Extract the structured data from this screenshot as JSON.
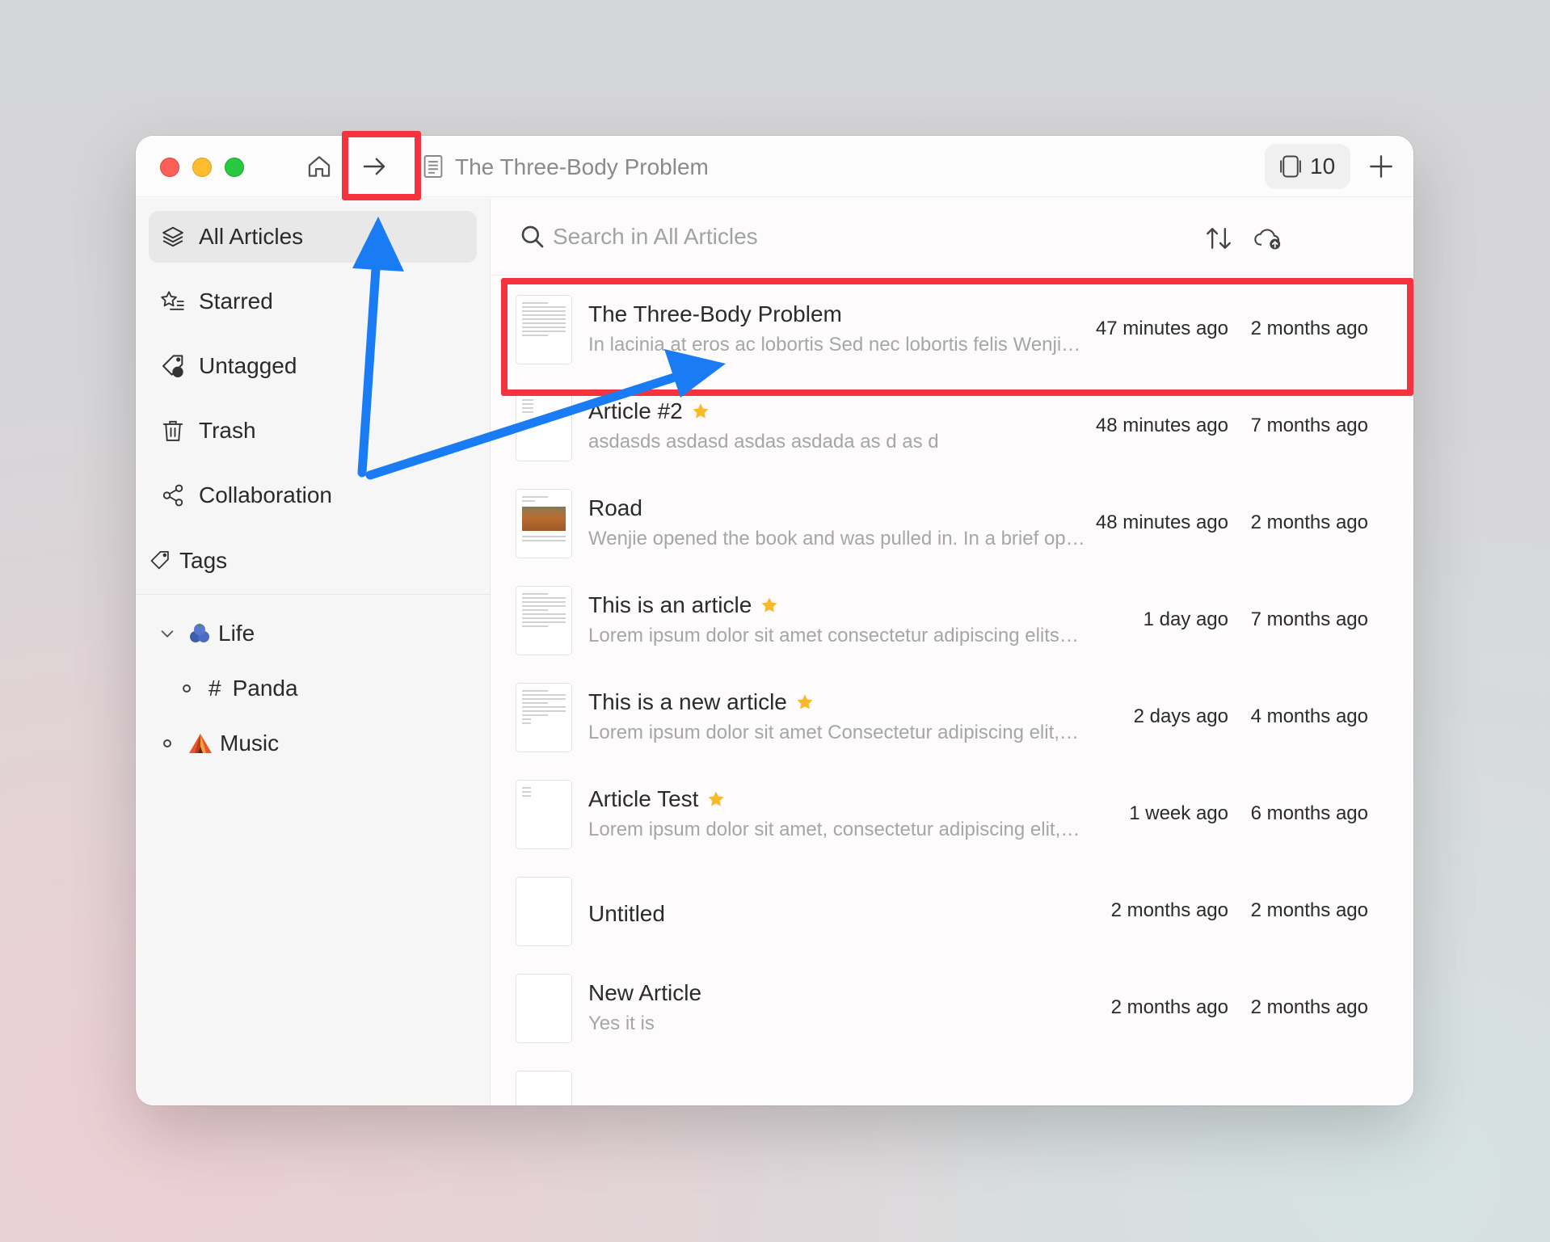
{
  "window": {
    "tab_title": "The Three-Body Problem",
    "tab_count": "10"
  },
  "sidebar": {
    "items": [
      {
        "label": "All Articles",
        "icon": "stack-icon",
        "active": true
      },
      {
        "label": "Starred",
        "icon": "star-list-icon"
      },
      {
        "label": "Untagged",
        "icon": "tag-question-icon"
      },
      {
        "label": "Trash",
        "icon": "trash-icon"
      },
      {
        "label": "Collaboration",
        "icon": "share-icon"
      }
    ],
    "tags_header": "Tags",
    "tags": [
      {
        "label": "Life",
        "icon": "blueberry-emoji",
        "expanded": true
      },
      {
        "label": "Panda",
        "prefix": "#"
      },
      {
        "label": "Music",
        "icon": "tent-emoji"
      }
    ]
  },
  "search": {
    "placeholder": "Search in All Articles"
  },
  "articles": [
    {
      "title": "The Three-Body Problem",
      "snippet": "In lacinia at eros ac lobortis Sed nec lobortis felis Wenji…",
      "modified": "47 minutes ago",
      "created": "2 months ago",
      "starred": false
    },
    {
      "title": "Article #2",
      "snippet": "asdasds asdasd asdas asdada as d as d",
      "modified": "48 minutes ago",
      "created": "7 months ago",
      "starred": true
    },
    {
      "title": "Road",
      "snippet": "Wenjie opened the book and was pulled in. In a brief op…",
      "modified": "48 minutes ago",
      "created": "2 months ago",
      "starred": false
    },
    {
      "title": "This is an article",
      "snippet": "Lorem ipsum dolor sit amet consectetur adipiscing elits…",
      "modified": "1 day ago",
      "created": "7 months ago",
      "starred": true
    },
    {
      "title": "This is a new article",
      "snippet": "Lorem ipsum dolor sit amet Consectetur adipiscing elit,…",
      "modified": "2 days ago",
      "created": "4 months ago",
      "starred": true
    },
    {
      "title": "Article Test",
      "snippet": "Lorem ipsum dolor sit amet, consectetur adipiscing elit,…",
      "modified": "1 week ago",
      "created": "6 months ago",
      "starred": true
    },
    {
      "title": "Untitled",
      "snippet": "",
      "modified": "2 months ago",
      "created": "2 months ago",
      "starred": false
    },
    {
      "title": "New Article",
      "snippet": "Yes it is",
      "modified": "2 months ago",
      "created": "2 months ago",
      "starred": false
    }
  ],
  "colors": {
    "annotation_red": "#f5333f",
    "annotation_blue": "#1a7cf5",
    "star_yellow": "#f7b82a"
  }
}
